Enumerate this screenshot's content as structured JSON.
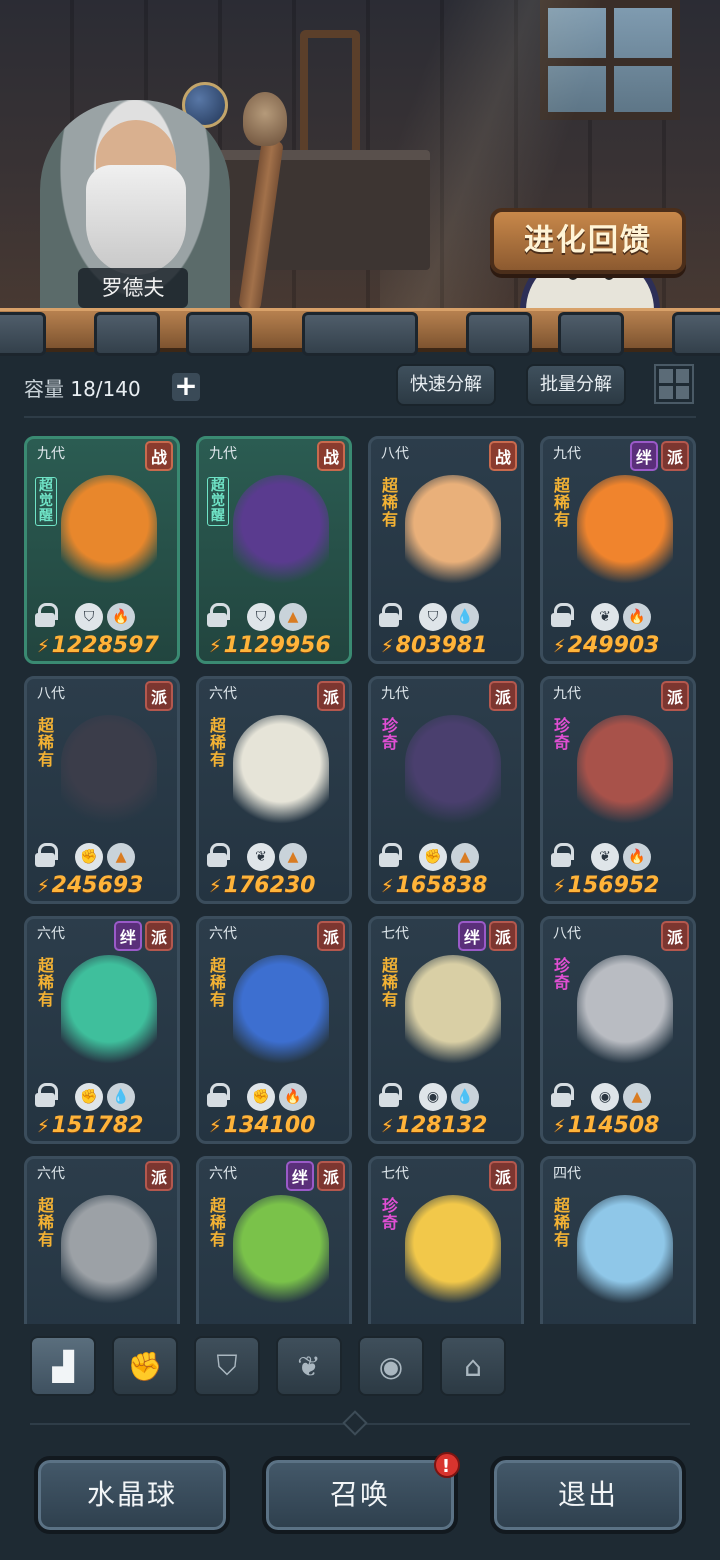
{
  "scene": {
    "npc_name": "罗德夫",
    "evolve_button": "进化回馈"
  },
  "toolbar": {
    "capacity_label": "容量",
    "capacity_value": "18/140",
    "plus": "+",
    "quick_decompose": "快速分解",
    "batch_decompose": "批量分解"
  },
  "cards": [
    {
      "gen": "九代",
      "tags": [
        "战"
      ],
      "rarity": "超觉醒",
      "rarity_kind": "awake",
      "awaken": true,
      "traits": [
        "shield",
        "fire"
      ],
      "power": "1228597",
      "art": "#e8872c"
    },
    {
      "gen": "九代",
      "tags": [
        "战"
      ],
      "rarity": "超觉醒",
      "rarity_kind": "awake",
      "awaken": true,
      "traits": [
        "shield",
        "earth"
      ],
      "power": "1129956",
      "art": "#5a3b8f"
    },
    {
      "gen": "八代",
      "tags": [
        "战"
      ],
      "rarity": "超稀有",
      "rarity_kind": "super",
      "awaken": false,
      "traits": [
        "shield",
        "water"
      ],
      "power": "803981",
      "art": "#e9b07a"
    },
    {
      "gen": "九代",
      "tags": [
        "绊",
        "派"
      ],
      "rarity": "超稀有",
      "rarity_kind": "super",
      "awaken": false,
      "traits": [
        "leaf",
        "fire"
      ],
      "power": "249903",
      "art": "#f0842d"
    },
    {
      "gen": "八代",
      "tags": [
        "派"
      ],
      "rarity": "超稀有",
      "rarity_kind": "super",
      "awaken": false,
      "traits": [
        "fist",
        "earth"
      ],
      "power": "245693",
      "art": "#3b3d4a"
    },
    {
      "gen": "六代",
      "tags": [
        "派"
      ],
      "rarity": "超稀有",
      "rarity_kind": "super",
      "awaken": false,
      "traits": [
        "leaf",
        "earth"
      ],
      "power": "176230",
      "art": "#e6e4d8"
    },
    {
      "gen": "九代",
      "tags": [
        "派"
      ],
      "rarity": "珍奇",
      "rarity_kind": "rare",
      "awaken": false,
      "traits": [
        "fist",
        "earth"
      ],
      "power": "165838",
      "art": "#4a3f6e"
    },
    {
      "gen": "九代",
      "tags": [
        "派"
      ],
      "rarity": "珍奇",
      "rarity_kind": "rare",
      "awaken": false,
      "traits": [
        "leaf",
        "fire"
      ],
      "power": "156952",
      "art": "#a8524a"
    },
    {
      "gen": "六代",
      "tags": [
        "绊",
        "派"
      ],
      "rarity": "超稀有",
      "rarity_kind": "super",
      "awaken": false,
      "traits": [
        "fist",
        "water"
      ],
      "power": "151782",
      "art": "#3fbf9c"
    },
    {
      "gen": "六代",
      "tags": [
        "派"
      ],
      "rarity": "超稀有",
      "rarity_kind": "super",
      "awaken": false,
      "traits": [
        "fist",
        "fire"
      ],
      "power": "134100",
      "art": "#3d6fd0"
    },
    {
      "gen": "七代",
      "tags": [
        "绊",
        "派"
      ],
      "rarity": "超稀有",
      "rarity_kind": "super",
      "awaken": false,
      "traits": [
        "alien",
        "water"
      ],
      "power": "128132",
      "art": "#d9cfa5"
    },
    {
      "gen": "八代",
      "tags": [
        "派"
      ],
      "rarity": "珍奇",
      "rarity_kind": "rare",
      "awaken": false,
      "traits": [
        "alien",
        "earth"
      ],
      "power": "114508",
      "art": "#b9bcc2"
    },
    {
      "gen": "六代",
      "tags": [
        "派"
      ],
      "rarity": "超稀有",
      "rarity_kind": "super",
      "awaken": false,
      "traits": [],
      "power": "",
      "art": "#9ca1a6"
    },
    {
      "gen": "六代",
      "tags": [
        "绊",
        "派"
      ],
      "rarity": "超稀有",
      "rarity_kind": "super",
      "awaken": false,
      "traits": [],
      "power": "",
      "art": "#7ac24a"
    },
    {
      "gen": "七代",
      "tags": [
        "派"
      ],
      "rarity": "珍奇",
      "rarity_kind": "rare",
      "awaken": false,
      "traits": [],
      "power": "",
      "art": "#f2c84a"
    },
    {
      "gen": "四代",
      "tags": [],
      "rarity": "超稀有",
      "rarity_kind": "super",
      "awaken": false,
      "traits": [],
      "power": "",
      "art": "#8fc7e8"
    }
  ],
  "filters": [
    {
      "name": "all",
      "icon": "▟",
      "active": true
    },
    {
      "name": "fist",
      "icon": "✊",
      "active": false
    },
    {
      "name": "shield",
      "icon": "⛉",
      "active": false
    },
    {
      "name": "leaf",
      "icon": "❦",
      "active": false
    },
    {
      "name": "alien",
      "icon": "◉",
      "active": false
    },
    {
      "name": "building",
      "icon": "⌂",
      "active": false
    }
  ],
  "bottom": {
    "crystal_ball": "水晶球",
    "summon": "召唤",
    "summon_badge": "!",
    "exit": "退出"
  }
}
